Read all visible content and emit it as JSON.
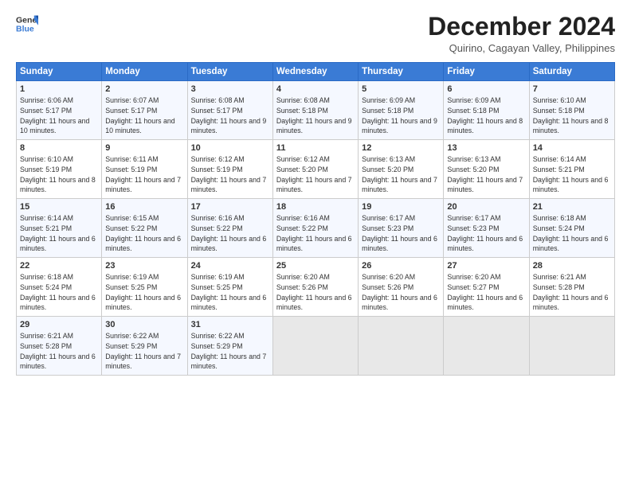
{
  "logo": {
    "general": "General",
    "blue": "Blue"
  },
  "header": {
    "title": "December 2024",
    "location": "Quirino, Cagayan Valley, Philippines"
  },
  "weekdays": [
    "Sunday",
    "Monday",
    "Tuesday",
    "Wednesday",
    "Thursday",
    "Friday",
    "Saturday"
  ],
  "weeks": [
    [
      {
        "day": "1",
        "sunrise": "Sunrise: 6:06 AM",
        "sunset": "Sunset: 5:17 PM",
        "daylight": "Daylight: 11 hours and 10 minutes."
      },
      {
        "day": "2",
        "sunrise": "Sunrise: 6:07 AM",
        "sunset": "Sunset: 5:17 PM",
        "daylight": "Daylight: 11 hours and 10 minutes."
      },
      {
        "day": "3",
        "sunrise": "Sunrise: 6:08 AM",
        "sunset": "Sunset: 5:17 PM",
        "daylight": "Daylight: 11 hours and 9 minutes."
      },
      {
        "day": "4",
        "sunrise": "Sunrise: 6:08 AM",
        "sunset": "Sunset: 5:18 PM",
        "daylight": "Daylight: 11 hours and 9 minutes."
      },
      {
        "day": "5",
        "sunrise": "Sunrise: 6:09 AM",
        "sunset": "Sunset: 5:18 PM",
        "daylight": "Daylight: 11 hours and 9 minutes."
      },
      {
        "day": "6",
        "sunrise": "Sunrise: 6:09 AM",
        "sunset": "Sunset: 5:18 PM",
        "daylight": "Daylight: 11 hours and 8 minutes."
      },
      {
        "day": "7",
        "sunrise": "Sunrise: 6:10 AM",
        "sunset": "Sunset: 5:18 PM",
        "daylight": "Daylight: 11 hours and 8 minutes."
      }
    ],
    [
      {
        "day": "8",
        "sunrise": "Sunrise: 6:10 AM",
        "sunset": "Sunset: 5:19 PM",
        "daylight": "Daylight: 11 hours and 8 minutes."
      },
      {
        "day": "9",
        "sunrise": "Sunrise: 6:11 AM",
        "sunset": "Sunset: 5:19 PM",
        "daylight": "Daylight: 11 hours and 7 minutes."
      },
      {
        "day": "10",
        "sunrise": "Sunrise: 6:12 AM",
        "sunset": "Sunset: 5:19 PM",
        "daylight": "Daylight: 11 hours and 7 minutes."
      },
      {
        "day": "11",
        "sunrise": "Sunrise: 6:12 AM",
        "sunset": "Sunset: 5:20 PM",
        "daylight": "Daylight: 11 hours and 7 minutes."
      },
      {
        "day": "12",
        "sunrise": "Sunrise: 6:13 AM",
        "sunset": "Sunset: 5:20 PM",
        "daylight": "Daylight: 11 hours and 7 minutes."
      },
      {
        "day": "13",
        "sunrise": "Sunrise: 6:13 AM",
        "sunset": "Sunset: 5:20 PM",
        "daylight": "Daylight: 11 hours and 7 minutes."
      },
      {
        "day": "14",
        "sunrise": "Sunrise: 6:14 AM",
        "sunset": "Sunset: 5:21 PM",
        "daylight": "Daylight: 11 hours and 6 minutes."
      }
    ],
    [
      {
        "day": "15",
        "sunrise": "Sunrise: 6:14 AM",
        "sunset": "Sunset: 5:21 PM",
        "daylight": "Daylight: 11 hours and 6 minutes."
      },
      {
        "day": "16",
        "sunrise": "Sunrise: 6:15 AM",
        "sunset": "Sunset: 5:22 PM",
        "daylight": "Daylight: 11 hours and 6 minutes."
      },
      {
        "day": "17",
        "sunrise": "Sunrise: 6:16 AM",
        "sunset": "Sunset: 5:22 PM",
        "daylight": "Daylight: 11 hours and 6 minutes."
      },
      {
        "day": "18",
        "sunrise": "Sunrise: 6:16 AM",
        "sunset": "Sunset: 5:22 PM",
        "daylight": "Daylight: 11 hours and 6 minutes."
      },
      {
        "day": "19",
        "sunrise": "Sunrise: 6:17 AM",
        "sunset": "Sunset: 5:23 PM",
        "daylight": "Daylight: 11 hours and 6 minutes."
      },
      {
        "day": "20",
        "sunrise": "Sunrise: 6:17 AM",
        "sunset": "Sunset: 5:23 PM",
        "daylight": "Daylight: 11 hours and 6 minutes."
      },
      {
        "day": "21",
        "sunrise": "Sunrise: 6:18 AM",
        "sunset": "Sunset: 5:24 PM",
        "daylight": "Daylight: 11 hours and 6 minutes."
      }
    ],
    [
      {
        "day": "22",
        "sunrise": "Sunrise: 6:18 AM",
        "sunset": "Sunset: 5:24 PM",
        "daylight": "Daylight: 11 hours and 6 minutes."
      },
      {
        "day": "23",
        "sunrise": "Sunrise: 6:19 AM",
        "sunset": "Sunset: 5:25 PM",
        "daylight": "Daylight: 11 hours and 6 minutes."
      },
      {
        "day": "24",
        "sunrise": "Sunrise: 6:19 AM",
        "sunset": "Sunset: 5:25 PM",
        "daylight": "Daylight: 11 hours and 6 minutes."
      },
      {
        "day": "25",
        "sunrise": "Sunrise: 6:20 AM",
        "sunset": "Sunset: 5:26 PM",
        "daylight": "Daylight: 11 hours and 6 minutes."
      },
      {
        "day": "26",
        "sunrise": "Sunrise: 6:20 AM",
        "sunset": "Sunset: 5:26 PM",
        "daylight": "Daylight: 11 hours and 6 minutes."
      },
      {
        "day": "27",
        "sunrise": "Sunrise: 6:20 AM",
        "sunset": "Sunset: 5:27 PM",
        "daylight": "Daylight: 11 hours and 6 minutes."
      },
      {
        "day": "28",
        "sunrise": "Sunrise: 6:21 AM",
        "sunset": "Sunset: 5:28 PM",
        "daylight": "Daylight: 11 hours and 6 minutes."
      }
    ],
    [
      {
        "day": "29",
        "sunrise": "Sunrise: 6:21 AM",
        "sunset": "Sunset: 5:28 PM",
        "daylight": "Daylight: 11 hours and 6 minutes."
      },
      {
        "day": "30",
        "sunrise": "Sunrise: 6:22 AM",
        "sunset": "Sunset: 5:29 PM",
        "daylight": "Daylight: 11 hours and 7 minutes."
      },
      {
        "day": "31",
        "sunrise": "Sunrise: 6:22 AM",
        "sunset": "Sunset: 5:29 PM",
        "daylight": "Daylight: 11 hours and 7 minutes."
      },
      null,
      null,
      null,
      null
    ]
  ]
}
